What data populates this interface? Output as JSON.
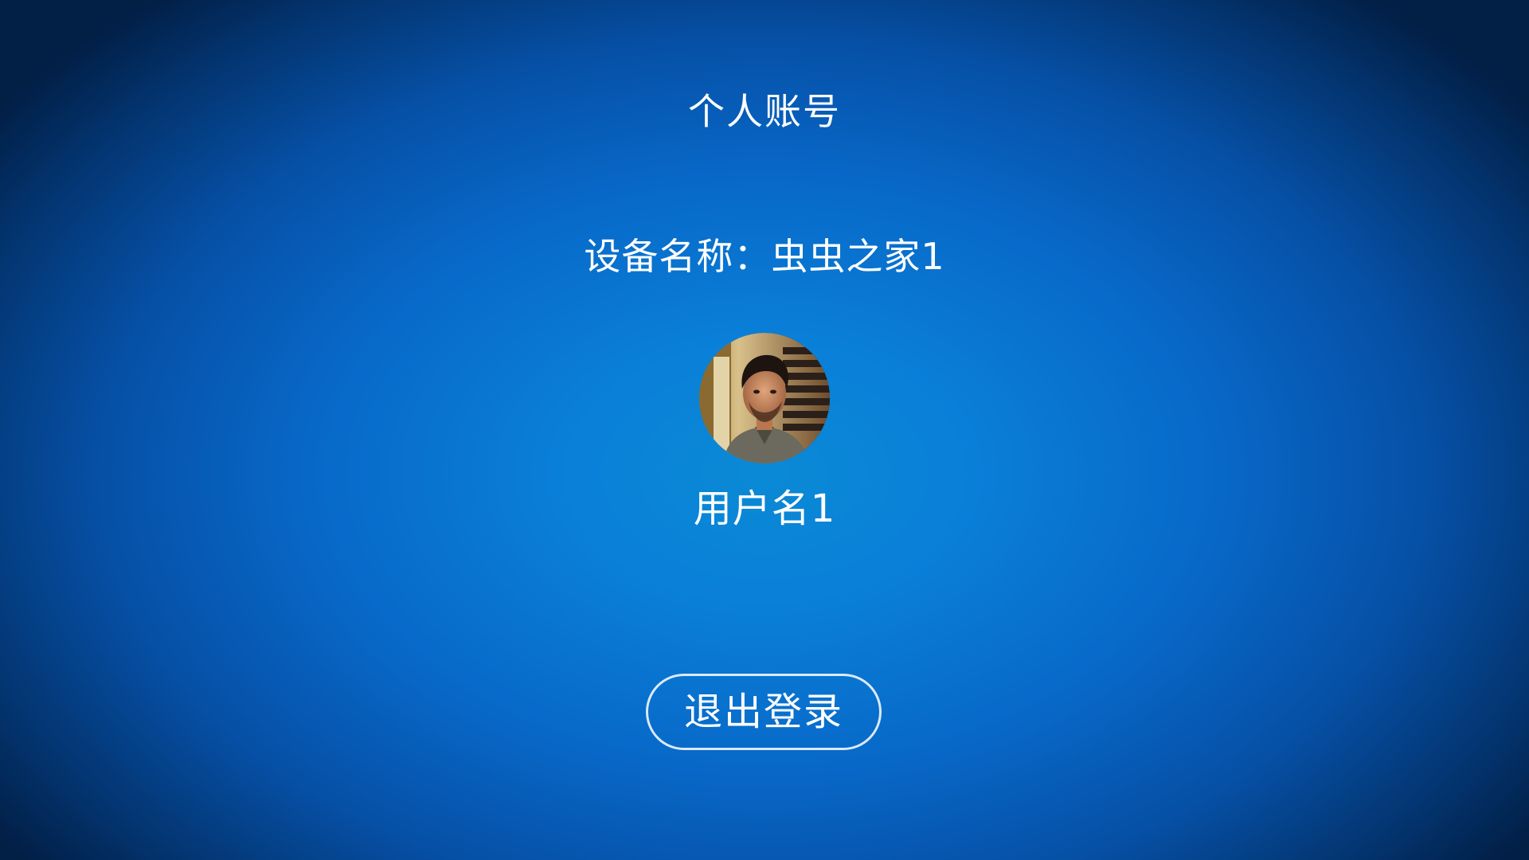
{
  "header": {
    "title": "个人账号"
  },
  "device": {
    "label": "设备名称：",
    "name": "虫虫之家1"
  },
  "user": {
    "avatar_icon": "user-avatar-photo",
    "name": "用户名1"
  },
  "actions": {
    "logout_label": "退出登录"
  },
  "colors": {
    "background_center": "#0a8ad6",
    "background_edge": "#021f46",
    "text": "#ffffff"
  }
}
